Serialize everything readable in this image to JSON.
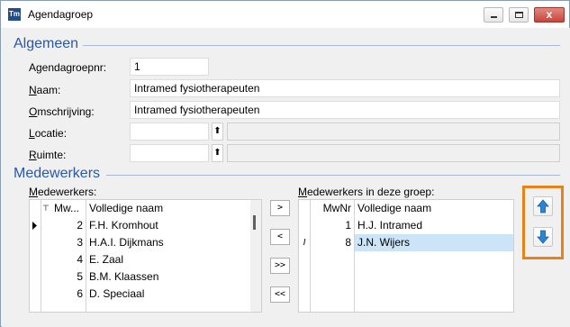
{
  "window": {
    "title": "Agendagroep",
    "icon": "tm-app-icon",
    "icon_text": "Tm",
    "close_label": "x"
  },
  "algemeen": {
    "title": "Algemeen",
    "agendagroepnr_label": "Agendagroepnr:",
    "agendagroepnr_value": "1",
    "naam_label_first": "N",
    "naam_label_rest": "aam:",
    "naam_value": "Intramed fysiotherapeuten",
    "omschrijving_label_first": "O",
    "omschrijving_label_rest": "mschrijving:",
    "omschrijving_value": "Intramed fysiotherapeuten",
    "locatie_label_first": "L",
    "locatie_label_rest": "ocatie:",
    "locatie_value": "",
    "ruimte_label_first": "R",
    "ruimte_label_rest": "uimte:",
    "ruimte_value": "",
    "lookup_arrow": "⬆"
  },
  "medewerkers": {
    "title": "Medewerkers",
    "left_label_first": "M",
    "left_label_rest": "edewerkers:",
    "right_label_first": "M",
    "right_label_rest": "edewerkers in deze groep:",
    "left_grid": {
      "col_nr": "Mw...",
      "col_name": "Volledige naam",
      "sort_icon": "⊤",
      "rows": [
        {
          "nr": "2",
          "name": "F.H. Kromhout",
          "current": true
        },
        {
          "nr": "3",
          "name": "H.A.I. Dijkmans"
        },
        {
          "nr": "4",
          "name": "E. Zaal"
        },
        {
          "nr": "5",
          "name": "B.M. Klaassen"
        },
        {
          "nr": "6",
          "name": "D. Speciaal"
        }
      ]
    },
    "right_grid": {
      "col_nr": "MwNr",
      "col_name": "Volledige naam",
      "rows": [
        {
          "nr": "1",
          "name": "H.J. Intramed"
        },
        {
          "nr": "8",
          "name": "J.N. Wijers",
          "selected": true,
          "edit_marker": "I"
        }
      ]
    },
    "buttons": {
      "add": ">",
      "remove": "<",
      "add_all": ">>",
      "remove_all": "<<"
    },
    "move_up_icon": "arrow-up-icon",
    "move_down_icon": "arrow-down-icon"
  },
  "colors": {
    "accent": "#2b57a8",
    "highlight": "#e8811a",
    "selection": "#cce4f7",
    "arrow_blue": "#2a86d4"
  }
}
